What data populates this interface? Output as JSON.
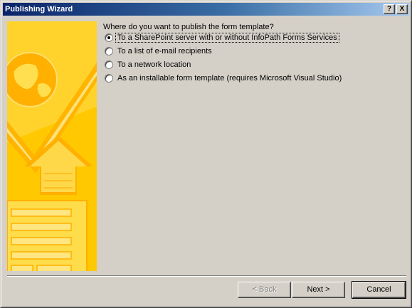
{
  "window": {
    "title": "Publishing Wizard",
    "help_button": "?",
    "close_button": "X"
  },
  "main": {
    "question": "Where do you want to publish the form template?",
    "options": [
      {
        "label": "To a SharePoint server with or without InfoPath Forms Services",
        "checked": true
      },
      {
        "label": "To a list of e-mail recipients",
        "checked": false
      },
      {
        "label": "To a network location",
        "checked": false
      },
      {
        "label": "As an installable form template (requires Microsoft Visual Studio)",
        "checked": false
      }
    ]
  },
  "footer": {
    "back_label": "< Back",
    "next_label": "Next >",
    "cancel_label": "Cancel"
  },
  "colors": {
    "titlebar_start": "#0a246a",
    "titlebar_end": "#a6caf0",
    "dialog_bg": "#d4d0c8",
    "banner_yellow": "#ffcc00"
  }
}
